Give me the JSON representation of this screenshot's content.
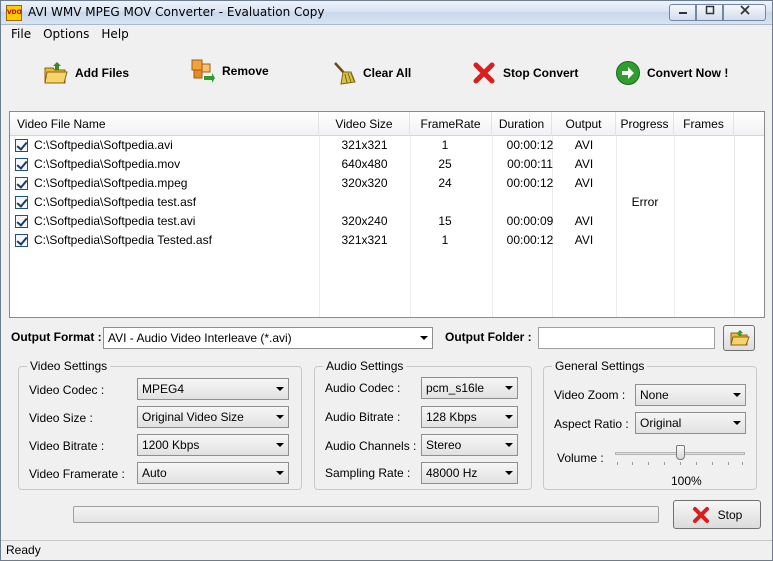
{
  "window": {
    "title": "AVI WMV MPEG MOV Converter - Evaluation Copy",
    "icon_text": "VDO"
  },
  "menu": [
    "File",
    "Options",
    "Help"
  ],
  "toolbar": {
    "add_files": "Add Files",
    "remove": "Remove",
    "clear_all": "Clear All",
    "stop_convert": "Stop Convert",
    "convert_now": "Convert Now !"
  },
  "table": {
    "columns": [
      "Video File Name",
      "Video Size",
      "FrameRate",
      "Duration",
      "Output",
      "Progress",
      "Frames"
    ],
    "rows": [
      {
        "name": "C:\\Softpedia\\Softpedia.avi",
        "size": "321x321",
        "framerate": "1",
        "duration": "00:00:12",
        "output": "AVI",
        "progress": "",
        "frames": ""
      },
      {
        "name": "C:\\Softpedia\\Softpedia.mov",
        "size": "640x480",
        "framerate": "25",
        "duration": "00:00:11",
        "output": "AVI",
        "progress": "",
        "frames": ""
      },
      {
        "name": "C:\\Softpedia\\Softpedia.mpeg",
        "size": "320x320",
        "framerate": "24",
        "duration": "00:00:12",
        "output": "AVI",
        "progress": "",
        "frames": ""
      },
      {
        "name": "C:\\Softpedia\\Softpedia test.asf",
        "size": "",
        "framerate": "",
        "duration": "",
        "output": "",
        "progress": "Error",
        "frames": ""
      },
      {
        "name": "C:\\Softpedia\\Softpedia test.avi",
        "size": "320x240",
        "framerate": "15",
        "duration": "00:00:09",
        "output": "AVI",
        "progress": "",
        "frames": ""
      },
      {
        "name": "C:\\Softpedia\\Softpedia Tested.asf",
        "size": "321x321",
        "framerate": "1",
        "duration": "00:00:12",
        "output": "AVI",
        "progress": "",
        "frames": ""
      }
    ]
  },
  "output": {
    "format_label": "Output Format :",
    "format_value": "AVI - Audio Video Interleave (*.avi)",
    "folder_label": "Output Folder :",
    "folder_value": ""
  },
  "video_settings": {
    "title": "Video Settings",
    "codec_label": "Video Codec :",
    "codec_value": "MPEG4",
    "size_label": "Video Size :",
    "size_value": "Original Video Size",
    "bitrate_label": "Video Bitrate :",
    "bitrate_value": "1200 Kbps",
    "framerate_label": "Video Framerate :",
    "framerate_value": "Auto"
  },
  "audio_settings": {
    "title": "Audio Settings",
    "codec_label": "Audio Codec :",
    "codec_value": "pcm_s16le",
    "bitrate_label": "Audio Bitrate :",
    "bitrate_value": "128 Kbps",
    "channels_label": "Audio Channels :",
    "channels_value": "Stereo",
    "sampling_label": "Sampling Rate :",
    "sampling_value": "48000 Hz"
  },
  "general_settings": {
    "title": "General Settings",
    "zoom_label": "Video Zoom :",
    "zoom_value": "None",
    "aspect_label": "Aspect Ratio :",
    "aspect_value": "Original",
    "volume_label": "Volume :",
    "volume_value": "100%",
    "volume_fraction": 0.5
  },
  "progress_fraction": 0,
  "stop_label": "Stop",
  "status": "Ready",
  "colors": {
    "accent_green": "#2e9e2e",
    "stop_red": "#d81e1e"
  }
}
